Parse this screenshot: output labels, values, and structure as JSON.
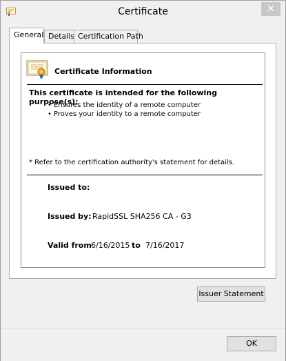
{
  "window": {
    "title": "Certificate",
    "close_symbol": "✕"
  },
  "tabs": [
    {
      "label": "General",
      "active": true
    },
    {
      "label": "Details",
      "active": false
    },
    {
      "label": "Certification Path",
      "active": false
    }
  ],
  "general": {
    "heading": "Certificate Information",
    "purpose_heading": "This certificate is intended for the following purpose(s):",
    "purposes": [
      "Ensures the identity of a remote computer",
      "Proves your identity to a remote computer"
    ],
    "note": "* Refer to the certification authority's statement for details.",
    "issued_to_label": "Issued to:",
    "issued_to_value": "",
    "issued_by_label": "Issued by:",
    "issued_by_value": "RapidSSL SHA256 CA - G3",
    "valid_from_label": "Valid from",
    "valid_from_value": "6/16/2015",
    "valid_to_label": "to",
    "valid_to_value": "7/16/2017"
  },
  "buttons": {
    "issuer_statement": "Issuer Statement",
    "ok": "OK"
  },
  "icons": {
    "title": "certificate-icon",
    "info": "certificate-icon"
  }
}
